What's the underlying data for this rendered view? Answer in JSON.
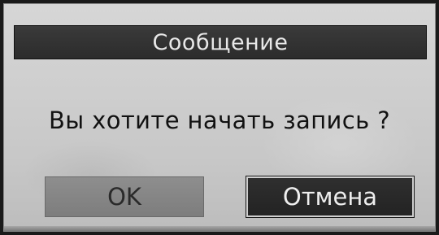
{
  "dialog": {
    "title": "Сообщение",
    "message": "Вы хотите начать запись ?",
    "buttons": {
      "ok_label": "OK",
      "cancel_label": "Отмена"
    },
    "focused_button": "cancel"
  }
}
